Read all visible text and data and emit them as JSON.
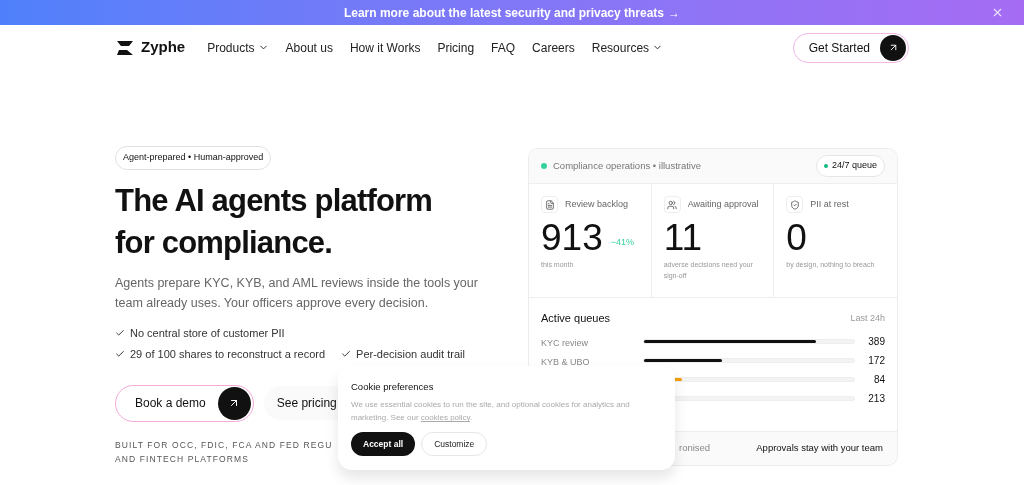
{
  "banner": {
    "text": "Learn more about the latest security and privacy threats",
    "arrow": "→"
  },
  "nav": {
    "logo": "Zyphe",
    "links": [
      {
        "label": "Products",
        "dropdown": true
      },
      {
        "label": "About us",
        "dropdown": false
      },
      {
        "label": "How it Works",
        "dropdown": false
      },
      {
        "label": "Pricing",
        "dropdown": false
      },
      {
        "label": "FAQ",
        "dropdown": false
      },
      {
        "label": "Careers",
        "dropdown": false
      },
      {
        "label": "Resources",
        "dropdown": true
      }
    ],
    "cta": "Get Started"
  },
  "hero": {
    "badge": "Agent-prepared • Human-approved",
    "title_lines": [
      "The AI agents platform",
      "for compliance."
    ],
    "description": "Agents prepare KYC, KYB, and AML reviews inside the tools your team already uses. Your officers approve every decision.",
    "checks": [
      "No central store of customer PII",
      "29 of 100 shares to reconstruct a record",
      "Per-decision audit trail"
    ],
    "primary_button": "Book a demo",
    "secondary_button": "See pricing",
    "built_for": [
      "BUILT FOR OCC, FDIC, FCA AND FED REGU",
      "AND FINTECH PLATFORMS"
    ]
  },
  "panel": {
    "title": "Compliance operations • illustrative",
    "status": "24/7 queue",
    "stats": [
      {
        "kind": "document",
        "label": "Review backlog",
        "value": "913",
        "change": "−41%",
        "caption": "this month"
      },
      {
        "kind": "people",
        "label": "Awaiting approval",
        "value": "11",
        "caption": "adverse decisions need your sign-off"
      },
      {
        "kind": "shield",
        "label": "PII at rest",
        "value": "0",
        "caption": "by design, nothing to breach"
      }
    ],
    "queues_title": "Active queues",
    "queues_period": "Last 24h",
    "queues": [
      {
        "label": "KYC review",
        "level": 0.82,
        "count": "389",
        "color": "#111111"
      },
      {
        "label": "KYB & UBO",
        "level": 0.37,
        "count": "172",
        "color": "#111111"
      },
      {
        "level": 0.18,
        "count": "84",
        "color": "#f59e0b"
      },
      {
        "count": "213"
      }
    ],
    "footer": [
      "ronised",
      "Approvals stay with your team"
    ]
  },
  "cookie": {
    "title": "Cookie preferences",
    "text": "We use essential cookies to run the site, and optional cookies for analytics and marketing. See our ",
    "link": "cookies policy",
    "text_end": ".",
    "buttons": [
      "Accept all",
      "Customize"
    ]
  }
}
